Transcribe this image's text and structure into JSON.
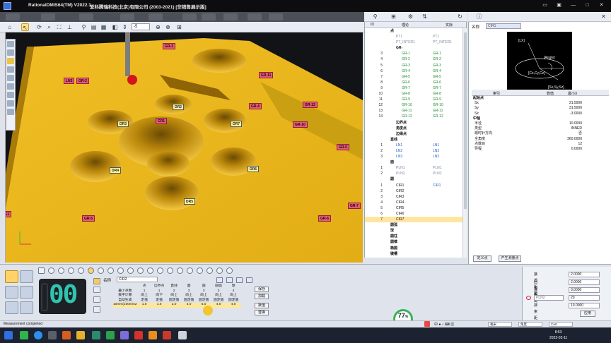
{
  "window": {
    "app_name": "RationalDMIS64(TM) V2022.1",
    "company": "爱科腾瑞科技(北京)有限公司 (2003-2021) [非销售展示版]",
    "minimize": "—",
    "maximize": "□",
    "close": "✕"
  },
  "toolbar": {
    "depth_value": "-5"
  },
  "viewport": {
    "labels": [
      {
        "text": "GR-3",
        "style": "pink"
      },
      {
        "text": "LN3",
        "style": "pink"
      },
      {
        "text": "GR-2",
        "style": "pink"
      },
      {
        "text": "GR-11",
        "style": "pink"
      },
      {
        "text": "DR2",
        "style": "yel"
      },
      {
        "text": "GR-4",
        "style": "pink"
      },
      {
        "text": "GR-12",
        "style": "pink"
      },
      {
        "text": "CR1",
        "style": "pink"
      },
      {
        "text": "DR3",
        "style": "yel"
      },
      {
        "text": "DR7",
        "style": "yel"
      },
      {
        "text": "GR-10",
        "style": "pink"
      },
      {
        "text": "GR-5",
        "style": "pink"
      },
      {
        "text": "DR4",
        "style": "yel"
      },
      {
        "text": "DR6",
        "style": "yel"
      },
      {
        "text": "DR5",
        "style": "yel"
      },
      {
        "text": "GR-7",
        "style": "pink"
      },
      {
        "text": "GR-5",
        "style": "pink"
      },
      {
        "text": "GR-6",
        "style": "pink"
      },
      {
        "text": "E1",
        "style": "pink"
      }
    ]
  },
  "tree": {
    "col_id": "ID",
    "col_theory": "理论",
    "col_actual": "实际",
    "rows": [
      {
        "id": "",
        "name": "点",
        "actual": "",
        "indent": 0,
        "kind": "group"
      },
      {
        "id": "",
        "name": "PT1",
        "actual": "PT1",
        "indent": 1,
        "kind": "dim"
      },
      {
        "id": "",
        "name": "PT_INTER1",
        "actual": "PT_INTER1",
        "indent": 1,
        "kind": "dim"
      },
      {
        "id": "",
        "name": "GR-",
        "actual": "",
        "indent": 1,
        "kind": "group"
      },
      {
        "id": "3",
        "name": "GR-1",
        "actual": "GR-1",
        "indent": 2,
        "kind": "green"
      },
      {
        "id": "4",
        "name": "GR-2",
        "actual": "GR-2",
        "indent": 2,
        "kind": "green"
      },
      {
        "id": "5",
        "name": "GR-3",
        "actual": "GR-3",
        "indent": 2,
        "kind": "green"
      },
      {
        "id": "6",
        "name": "GR-4",
        "actual": "GR-4",
        "indent": 2,
        "kind": "green"
      },
      {
        "id": "7",
        "name": "GR-5",
        "actual": "GR-5",
        "indent": 2,
        "kind": "green"
      },
      {
        "id": "8",
        "name": "GR-6",
        "actual": "GR-6",
        "indent": 2,
        "kind": "green"
      },
      {
        "id": "9",
        "name": "GR-7",
        "actual": "GR-7",
        "indent": 2,
        "kind": "green"
      },
      {
        "id": "10",
        "name": "GR-8",
        "actual": "GR-8",
        "indent": 2,
        "kind": "green"
      },
      {
        "id": "11",
        "name": "GR-9",
        "actual": "GR-9",
        "indent": 2,
        "kind": "green"
      },
      {
        "id": "12",
        "name": "GR-10",
        "actual": "GR-10",
        "indent": 2,
        "kind": "green"
      },
      {
        "id": "13",
        "name": "GR-11",
        "actual": "GR-11",
        "indent": 2,
        "kind": "green"
      },
      {
        "id": "14",
        "name": "GR-12",
        "actual": "GR-12",
        "indent": 2,
        "kind": "green"
      },
      {
        "id": "",
        "name": "边界点",
        "actual": "",
        "indent": 1,
        "kind": "group"
      },
      {
        "id": "",
        "name": "角度点",
        "actual": "",
        "indent": 1,
        "kind": "group"
      },
      {
        "id": "",
        "name": "边缘点",
        "actual": "",
        "indent": 1,
        "kind": "group"
      },
      {
        "id": "",
        "name": "直线",
        "actual": "",
        "indent": 0,
        "kind": "group"
      },
      {
        "id": "1",
        "name": "LN1",
        "actual": "LN1",
        "indent": 1,
        "kind": "blue"
      },
      {
        "id": "2",
        "name": "LN2",
        "actual": "LN2",
        "indent": 1,
        "kind": "blue"
      },
      {
        "id": "3",
        "name": "LN3",
        "actual": "LN3",
        "indent": 1,
        "kind": "blue"
      },
      {
        "id": "",
        "name": "面",
        "actual": "",
        "indent": 0,
        "kind": "group"
      },
      {
        "id": "1",
        "name": "PLN1",
        "actual": "PLN1",
        "indent": 1,
        "kind": "dim"
      },
      {
        "id": "2",
        "name": "PLN2",
        "actual": "PLN2",
        "indent": 1,
        "kind": "dim"
      },
      {
        "id": "",
        "name": "圆",
        "actual": "",
        "indent": 0,
        "kind": "group"
      },
      {
        "id": "1",
        "name": "CIR1",
        "actual": "CIR1",
        "indent": 1,
        "kind": "normal"
      },
      {
        "id": "2",
        "name": "CIR2",
        "actual": "",
        "indent": 1,
        "kind": "normal"
      },
      {
        "id": "3",
        "name": "CIR3",
        "actual": "",
        "indent": 1,
        "kind": "normal"
      },
      {
        "id": "4",
        "name": "CIR4",
        "actual": "",
        "indent": 1,
        "kind": "normal"
      },
      {
        "id": "5",
        "name": "CIR5",
        "actual": "",
        "indent": 1,
        "kind": "normal"
      },
      {
        "id": "6",
        "name": "CIR6",
        "actual": "",
        "indent": 1,
        "kind": "normal"
      },
      {
        "id": "7",
        "name": "CIR7",
        "actual": "",
        "indent": 1,
        "kind": "sel"
      },
      {
        "id": "",
        "name": "圆弧",
        "actual": "",
        "indent": 0,
        "kind": "group"
      },
      {
        "id": "",
        "name": "球",
        "actual": "",
        "indent": 0,
        "kind": "group"
      },
      {
        "id": "",
        "name": "圆柱",
        "actual": "",
        "indent": 0,
        "kind": "group"
      },
      {
        "id": "",
        "name": "圆锥",
        "actual": "",
        "indent": 0,
        "kind": "group"
      },
      {
        "id": "",
        "name": "椭圆",
        "actual": "",
        "indent": 0,
        "kind": "group"
      },
      {
        "id": "",
        "name": "键槽",
        "actual": "",
        "indent": 0,
        "kind": "group"
      }
    ]
  },
  "props": {
    "name_label": "名称",
    "name_value": "CIR1",
    "diagram_labels": [
      "[LX]",
      "[Angle]",
      "[Cx,Cy,Cz]",
      "[Sx,Sy,Sz]"
    ],
    "col_index": "索引",
    "col_value": "数值",
    "col_min": "最小X",
    "rows": [
      {
        "k": "起始点",
        "v": "",
        "group": true
      },
      {
        "k": "Sx",
        "v": "21.5000",
        "group": false
      },
      {
        "k": "Sy",
        "v": "31.5000",
        "group": false
      },
      {
        "k": "Sz",
        "v": "-3.0000",
        "group": false
      },
      {
        "k": "中轴",
        "v": "",
        "group": true
      },
      {
        "k": "半径",
        "v": "10.0000",
        "group": false
      },
      {
        "k": "类型",
        "v": "INNER",
        "group": false
      },
      {
        "k": "顺时针方向",
        "v": "否",
        "group": false
      },
      {
        "k": "全角度",
        "v": "360.0000",
        "group": false
      },
      {
        "k": "点数目",
        "v": "12",
        "group": false
      },
      {
        "k": "导程",
        "v": "0.0000",
        "group": false
      }
    ],
    "btn_define_point": "定义点",
    "btn_gen_points": "产生测量点"
  },
  "measure": {
    "counter": "00",
    "name_label": "名称",
    "name_value": "CIR2",
    "columns": [
      "点",
      "边界点",
      "直线",
      "面",
      "圆",
      "圆弧",
      "球"
    ],
    "rows": [
      {
        "label": "最少点数",
        "values": [
          "1",
          "1",
          "2",
          "3",
          "3",
          "3",
          "4"
        ]
      },
      {
        "label": "数字计算",
        "values": [
          "向上",
          "向下",
          "向上",
          "向上",
          "向上",
          "向上",
          "向上"
        ]
      },
      {
        "label": "自动生成",
        "values": [
          "定值",
          "定值",
          "固定值",
          "固定值",
          "固定值",
          "固定值",
          "固定值"
        ]
      },
      {
        "label": "10mm(100mm2",
        "values": [
          "1.0",
          "1.0",
          "2.0",
          "4.0",
          "5.0",
          "4.0",
          "4.0"
        ]
      }
    ],
    "btn_save": "保存",
    "btn_load": "加载",
    "btn_default": "默值",
    "btn_replace": "替换"
  },
  "progress": {
    "percent": "77",
    "unit": "%",
    "rate": "↑ 0.5K/s"
  },
  "right_settings": {
    "rows": [
      {
        "label": "接近距离",
        "value": "2.0000"
      },
      {
        "label": "回退距离",
        "value": "2.0000"
      },
      {
        "label": "深度",
        "value": "0.0000"
      },
      {
        "label": "",
        "value": "20"
      },
      {
        "label": "搜索距离",
        "value": "10.0000"
      }
    ],
    "plane_select": "PLN2",
    "apply": "应用"
  },
  "statusbar": {
    "text": "Measurement completed",
    "unit": "毫米",
    "angle": "角度",
    "coord": "Cart"
  },
  "taskbar": {
    "time": "8:53",
    "date": "2022-02-11"
  },
  "colors": {
    "part_yellow": "#e7b61e",
    "part_shadow": "#a27708",
    "viewport_bg": "#121316",
    "pink_tag": "#e75a78",
    "yellow_tag": "#fff5a0",
    "progress_green": "#36b35c"
  }
}
